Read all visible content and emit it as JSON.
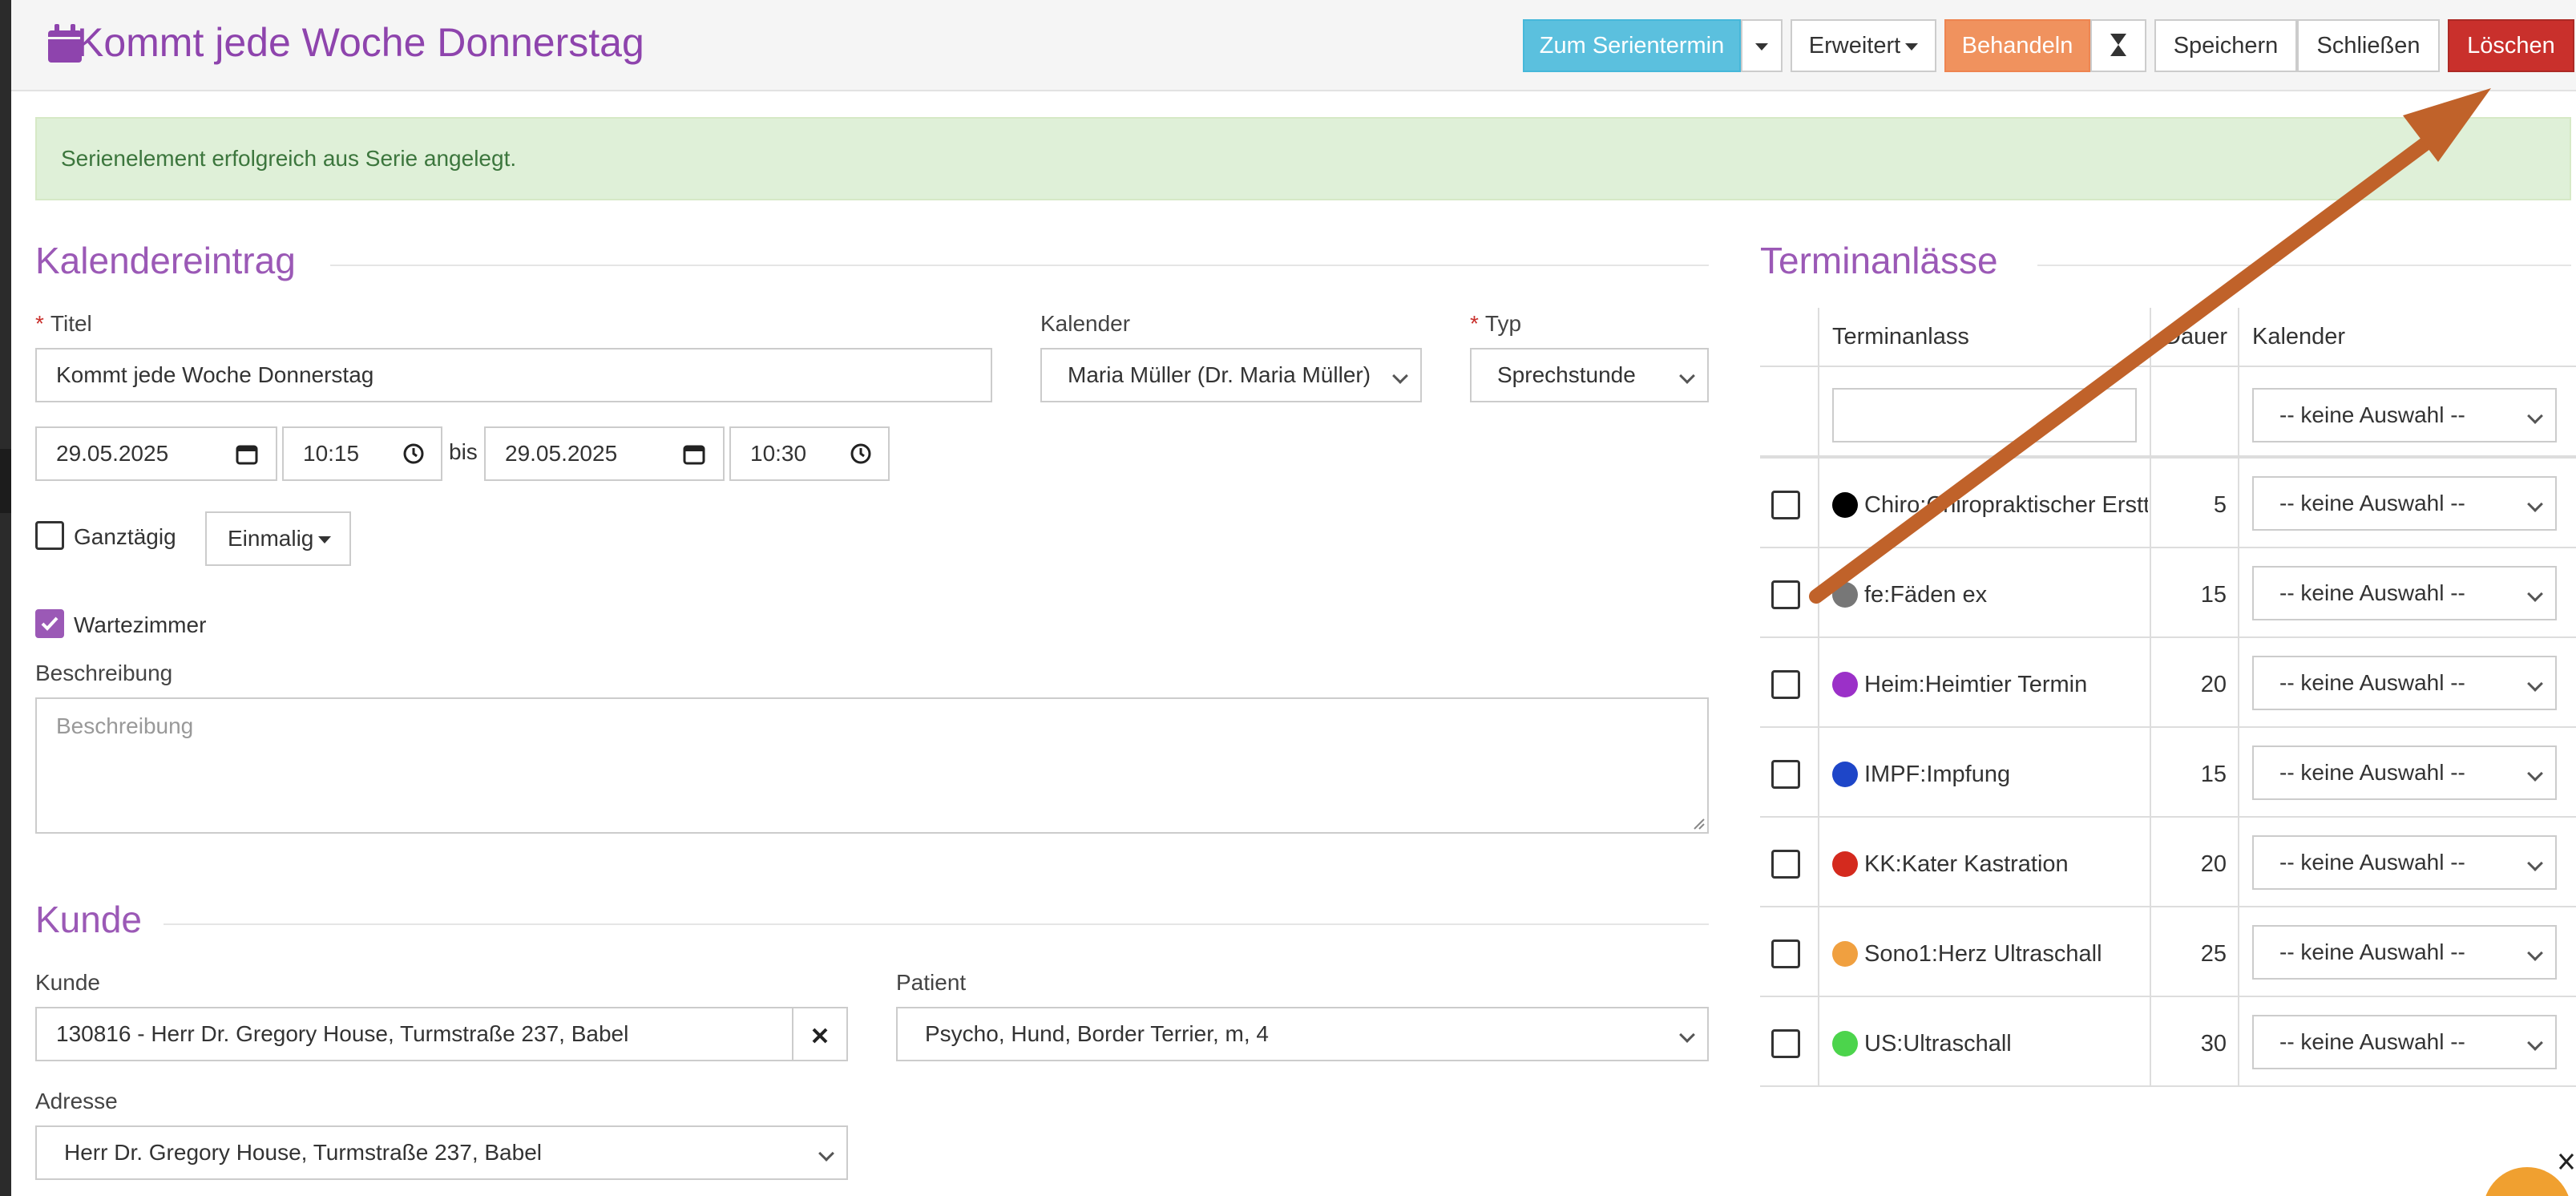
{
  "header": {
    "title": "Kommt jede Woche Donnerstag",
    "buttons": {
      "zum_serientermin": "Zum Serientermin",
      "erweitert": "Erweitert",
      "behandeln": "Behandeln",
      "speichern": "Speichern",
      "schliessen": "Schließen",
      "loeschen": "Löschen"
    }
  },
  "alert": {
    "text": "Serienelement erfolgreich aus Serie angelegt."
  },
  "kalendereintrag": {
    "section_title": "Kalendereintrag",
    "titel_label": "Titel",
    "titel_value": "Kommt jede Woche Donnerstag",
    "kalender_label": "Kalender",
    "kalender_value": "Maria Müller (Dr. Maria Müller)",
    "typ_label": "Typ",
    "typ_value": "Sprechstunde",
    "start_date": "29.05.2025",
    "start_time": "10:15",
    "bis_label": "bis",
    "end_date": "29.05.2025",
    "end_time": "10:30",
    "ganztaegig_label": "Ganztägig",
    "einmalig_label": "Einmalig",
    "wartezimmer_label": "Wartezimmer",
    "beschreibung_label": "Beschreibung",
    "beschreibung_placeholder": "Beschreibung"
  },
  "kunde": {
    "section_title": "Kunde",
    "kunde_label": "Kunde",
    "kunde_value": "130816 - Herr Dr. Gregory House, Turmstraße 237, Babel",
    "patient_label": "Patient",
    "patient_value": "Psycho, Hund, Border Terrier, m, 4",
    "adresse_label": "Adresse",
    "adresse_value": "Herr Dr. Gregory House, Turmstraße 237, Babel"
  },
  "terminanlaesse": {
    "section_title": "Terminanlässe",
    "columns": {
      "terminanlass": "Terminanlass",
      "dauer": "Dauer",
      "kalender": "Kalender"
    },
    "filter_kalender": "-- keine Auswahl --",
    "rows": [
      {
        "label": "Chiro:Chiropraktischer Erstte",
        "dauer": "5",
        "color": "#000000",
        "kalender": "-- keine Auswahl --"
      },
      {
        "label": "fe:Fäden ex",
        "dauer": "15",
        "color": "#777777",
        "kalender": "-- keine Auswahl --"
      },
      {
        "label": "Heim:Heimtier Termin",
        "dauer": "20",
        "color": "#9b30c8",
        "kalender": "-- keine Auswahl --"
      },
      {
        "label": "IMPF:Impfung",
        "dauer": "15",
        "color": "#1e46c8",
        "kalender": "-- keine Auswahl --"
      },
      {
        "label": "KK:Kater Kastration",
        "dauer": "20",
        "color": "#d42a1e",
        "kalender": "-- keine Auswahl --"
      },
      {
        "label": "Sono1:Herz Ultraschall",
        "dauer": "25",
        "color": "#f0a040",
        "kalender": "-- keine Auswahl --"
      },
      {
        "label": "US:Ultraschall",
        "dauer": "30",
        "color": "#4cd44c",
        "kalender": "-- keine Auswahl --"
      }
    ]
  },
  "colors": {
    "accent": "#9b59b6",
    "annotation_arrow": "#c0622a"
  }
}
